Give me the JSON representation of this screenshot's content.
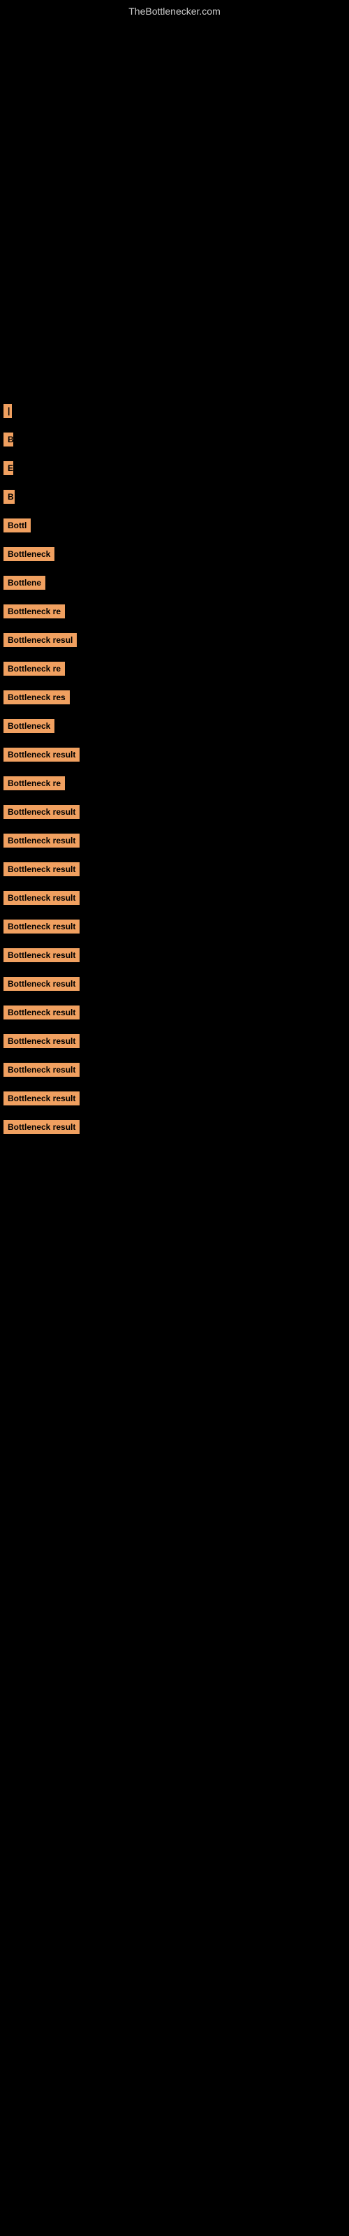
{
  "site": {
    "title": "TheBottlenecker.com"
  },
  "labels": [
    {
      "id": 1,
      "text": "|",
      "width": 8
    },
    {
      "id": 2,
      "text": "B",
      "width": 14
    },
    {
      "id": 3,
      "text": "E",
      "width": 14
    },
    {
      "id": 4,
      "text": "B",
      "width": 16
    },
    {
      "id": 5,
      "text": "Bottl",
      "width": 42
    },
    {
      "id": 6,
      "text": "Bottleneck",
      "width": 75
    },
    {
      "id": 7,
      "text": "Bottlene",
      "width": 62
    },
    {
      "id": 8,
      "text": "Bottleneck re",
      "width": 95
    },
    {
      "id": 9,
      "text": "Bottleneck resul",
      "width": 115
    },
    {
      "id": 10,
      "text": "Bottleneck re",
      "width": 95
    },
    {
      "id": 11,
      "text": "Bottleneck res",
      "width": 105
    },
    {
      "id": 12,
      "text": "Bottleneck",
      "width": 75
    },
    {
      "id": 13,
      "text": "Bottleneck result",
      "width": 120
    },
    {
      "id": 14,
      "text": "Bottleneck re",
      "width": 95
    },
    {
      "id": 15,
      "text": "Bottleneck result",
      "width": 120
    },
    {
      "id": 16,
      "text": "Bottleneck result",
      "width": 125
    },
    {
      "id": 17,
      "text": "Bottleneck result",
      "width": 130
    },
    {
      "id": 18,
      "text": "Bottleneck result",
      "width": 130
    },
    {
      "id": 19,
      "text": "Bottleneck result",
      "width": 130
    },
    {
      "id": 20,
      "text": "Bottleneck result",
      "width": 130
    },
    {
      "id": 21,
      "text": "Bottleneck result",
      "width": 130
    },
    {
      "id": 22,
      "text": "Bottleneck result",
      "width": 130
    },
    {
      "id": 23,
      "text": "Bottleneck result",
      "width": 130
    },
    {
      "id": 24,
      "text": "Bottleneck result",
      "width": 130
    },
    {
      "id": 25,
      "text": "Bottleneck result",
      "width": 130
    },
    {
      "id": 26,
      "text": "Bottleneck result",
      "width": 130
    }
  ]
}
